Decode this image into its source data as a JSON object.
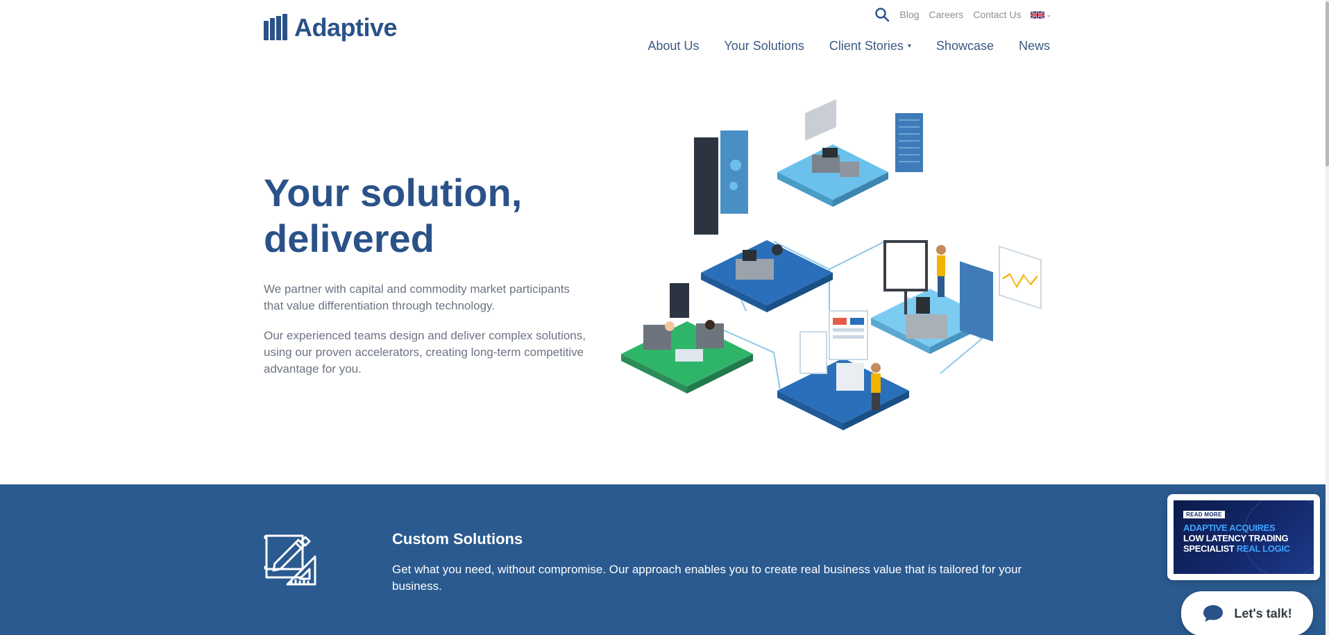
{
  "brand": {
    "name": "Adaptive",
    "color": "#2a5289"
  },
  "util_nav": {
    "search_icon": "search-icon",
    "links": [
      "Blog",
      "Careers",
      "Contact Us"
    ],
    "language_icon": "uk-flag-icon"
  },
  "main_nav": {
    "items": [
      {
        "label": "About Us"
      },
      {
        "label": "Your Solutions"
      },
      {
        "label": "Client Stories"
      },
      {
        "label": "Showcase"
      },
      {
        "label": "News"
      }
    ]
  },
  "hero": {
    "title_line1": "Your solution,",
    "title_line2": "delivered",
    "paragraph1": "We partner with capital and commodity market participants that value differentiation through technology.",
    "paragraph2": "Our experienced teams design and deliver complex solutions, using our proven accelerators, creating long-term competitive advantage for you."
  },
  "feature": {
    "icon": "blueprint-pencil-icon",
    "title": "Custom Solutions",
    "text": "Get what you need, without compromise. Our approach enables you to create real business value that is tailored for your business.",
    "band_color": "#2a5a8f"
  },
  "news_popup": {
    "badge": "READ MORE",
    "line1": "ADAPTIVE ACQUIRES",
    "line2": "LOW LATENCY TRADING",
    "line3a": "SPECIALIST ",
    "line3b": "REAL LOGIC"
  },
  "chat": {
    "label": "Let's talk!",
    "icon": "chat-bubble-icon"
  }
}
